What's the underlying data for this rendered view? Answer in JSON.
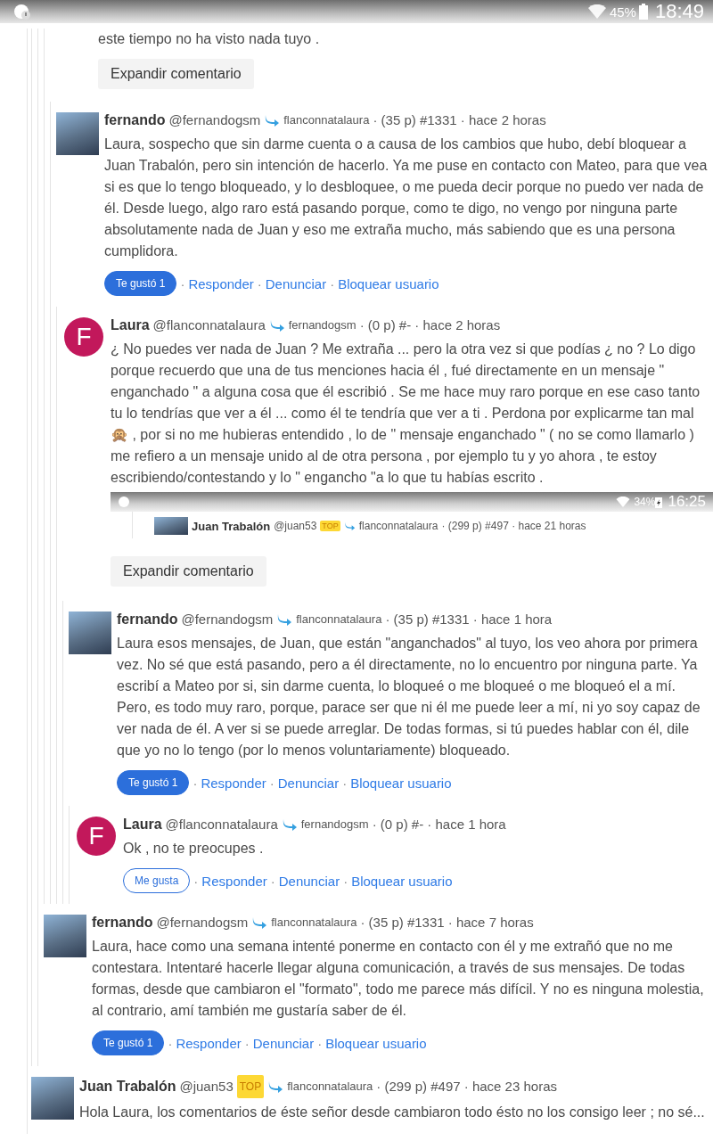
{
  "status_bar": {
    "battery": "45%",
    "time": "18:49"
  },
  "separator": "·",
  "comments": [
    {
      "kind": "thread",
      "replies": [
        {
          "kind": "thread",
          "replies": [
            {
              "kind": "thread",
              "replies": [
                {
                  "kind": "partial",
                  "body": "este tiempo no ha visto nada tuyo .",
                  "expand_button": "Expandir comentario",
                  "children": [
                    {
                      "kind": "comment",
                      "avatar": {
                        "kind": "photo"
                      },
                      "author": "fernando",
                      "handle": "@fernandogsm",
                      "reply_to": "flanconnatalaura",
                      "meta": "· (35 p) #1331 · hace 2 horas",
                      "body": "Laura, sospecho que sin darme cuenta o a causa de los cambios que hubo, debí bloquear a Juan Trabalón, pero sin intención de hacerlo. Ya me puse en contacto con Mateo, para que vea si es que lo tengo bloqueado, y lo desbloquee, o me pueda decir porque no puedo ver nada de él. Desde luego, algo raro está pasando porque, como te digo, no vengo por ninguna parte absolutamente nada de Juan y eso me extraña mucho, más sabiendo que es una persona cumplidora.",
                      "like": {
                        "label": "Te gustó 1",
                        "liked": true
                      },
                      "actions": [
                        "Responder",
                        "Denunciar",
                        "Bloquear usuario"
                      ],
                      "children": [
                        {
                          "kind": "comment",
                          "avatar": {
                            "kind": "letter",
                            "letter": "F"
                          },
                          "author": "Laura",
                          "handle": "@flanconnatalaura",
                          "reply_to": "fernandogsm",
                          "meta": "· (0 p) #- · hace 2 horas",
                          "body": "¿ No puedes ver nada de Juan ? Me extraña ... pero la otra vez si que podías ¿ no ? Lo digo porque recuerdo que una de tus menciones hacia él , fué directamente en un mensaje \" enganchado \" a alguna cosa que él escribió . Se me hace muy raro porque en ese caso tanto tu lo tendrías que ver a él ... como él te tendría que ver a ti . Perdona por explicarme tan mal 🙊 , por si no me hubieras entendido , lo de \" mensaje enganchado \" ( no se como llamarlo ) me refiero a un mensaje unido al de otra persona , por ejemplo tu y yo ahora , te estoy escribiendo/contestando y lo \" engancho \"a lo que tu habías escrito .",
                          "attachment": {
                            "battery": "34%",
                            "time": "16:25",
                            "author": "Juan Trabalón",
                            "handle": "@juan53",
                            "badge": "TOP",
                            "reply_to": "flanconnatalaura",
                            "meta": "· (299 p) #497 · hace 21 horas"
                          },
                          "expand_button": "Expandir comentario",
                          "children": [
                            {
                              "kind": "comment",
                              "avatar": {
                                "kind": "photo"
                              },
                              "author": "fernando",
                              "handle": "@fernandogsm",
                              "reply_to": "flanconnatalaura",
                              "meta": "· (35 p) #1331 · hace 1 hora",
                              "body": "Laura esos mensajes, de Juan, que están \"anganchados\" al tuyo, los veo ahora por primera vez. No sé que está pasando, pero a él directamente, no lo encuentro por ninguna parte. Ya escribí a Mateo por si, sin darme cuenta, lo bloqueé o me bloqueé o me bloqueó el a mí. Pero, es todo muy raro, porque, parace ser que ni él me puede leer a mí, ni yo soy capaz de ver nada de él. A ver si se puede arreglar. De todas formas, si tú puedes hablar con él, dile que yo no lo tengo (por lo menos voluntariamente) bloqueado.",
                              "like": {
                                "label": "Te gustó 1",
                                "liked": true
                              },
                              "actions": [
                                "Responder",
                                "Denunciar",
                                "Bloquear usuario"
                              ],
                              "children": [
                                {
                                  "kind": "comment",
                                  "avatar": {
                                    "kind": "letter",
                                    "letter": "F"
                                  },
                                  "author": "Laura",
                                  "handle": "@flanconnatalaura",
                                  "reply_to": "fernandogsm",
                                  "meta": "· (0 p) #- · hace 1 hora",
                                  "body": "Ok , no te preocupes .",
                                  "like": {
                                    "label": "Me gusta",
                                    "liked": false
                                  },
                                  "actions": [
                                    "Responder",
                                    "Denunciar",
                                    "Bloquear usuario"
                                  ]
                                }
                              ]
                            }
                          ]
                        }
                      ]
                    }
                  ]
                }
              ]
            },
            {
              "kind": "comment",
              "avatar": {
                "kind": "photo"
              },
              "author": "fernando",
              "handle": "@fernandogsm",
              "reply_to": "flanconnatalaura",
              "meta": "· (35 p) #1331 · hace 7 horas",
              "body": "Laura, hace como una semana intenté ponerme en contacto con él y me extrañó que no me contestara. Intentaré hacerle llegar alguna comunicación, a través de sus mensajes. De todas formas, desde que cambiaron el \"formato\", todo me parece más difícil. Y no es ninguna molestia, al contrario, amí también me gustaría saber de él.",
              "like": {
                "label": "Te gustó 1",
                "liked": true
              },
              "actions": [
                "Responder",
                "Denunciar",
                "Bloquear usuario"
              ]
            }
          ]
        }
      ]
    },
    {
      "kind": "comment",
      "avatar": {
        "kind": "photo"
      },
      "author": "Juan Trabalón",
      "handle": "@juan53",
      "badge": "TOP",
      "reply_to": "flanconnatalaura",
      "meta": "· (299 p) #497 · hace 23 horas",
      "body": "Hola Laura, los comentarios de éste señor desde cambiaron todo ésto no los consigo leer ; no sé..."
    }
  ]
}
